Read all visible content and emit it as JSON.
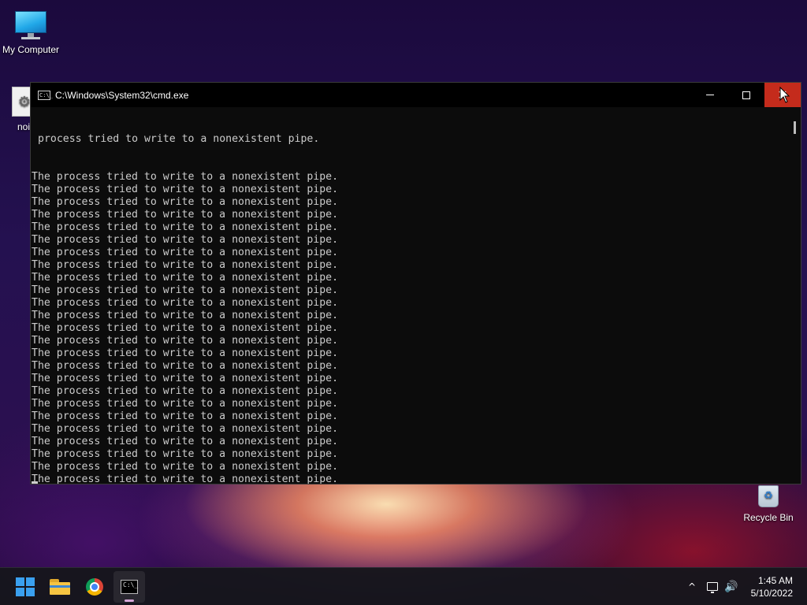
{
  "desktop": {
    "icons": [
      {
        "label": "My Computer",
        "icon": "monitor-icon"
      },
      {
        "label": "noic",
        "icon": "file-icon"
      },
      {
        "label": "Recycle Bin",
        "icon": "recycle-bin-icon"
      }
    ]
  },
  "window": {
    "title": "C:\\Windows\\System32\\cmd.exe",
    "app_icon_text": "C:\\_",
    "controls": {
      "minimize": "minimize-icon",
      "maximize": "maximize-icon",
      "close": "close-icon"
    },
    "first_line": "process tried to write to a nonexistent pipe.",
    "repeated_line": "The process tried to write to a nonexistent pipe.",
    "repeated_count": 28,
    "close_button_color": "#c42b1c"
  },
  "taskbar": {
    "items": [
      "start-icon",
      "file-explorer-icon",
      "chrome-icon",
      "command-prompt-icon"
    ],
    "tray": {
      "chevron": "^",
      "volume": "🔊"
    },
    "clock": {
      "time": "1:45 AM",
      "date": "5/10/2022"
    }
  },
  "colors": {
    "console_text": "#cccccc",
    "console_bg": "#0c0c0c",
    "start_accent": "#3aa0f0"
  }
}
